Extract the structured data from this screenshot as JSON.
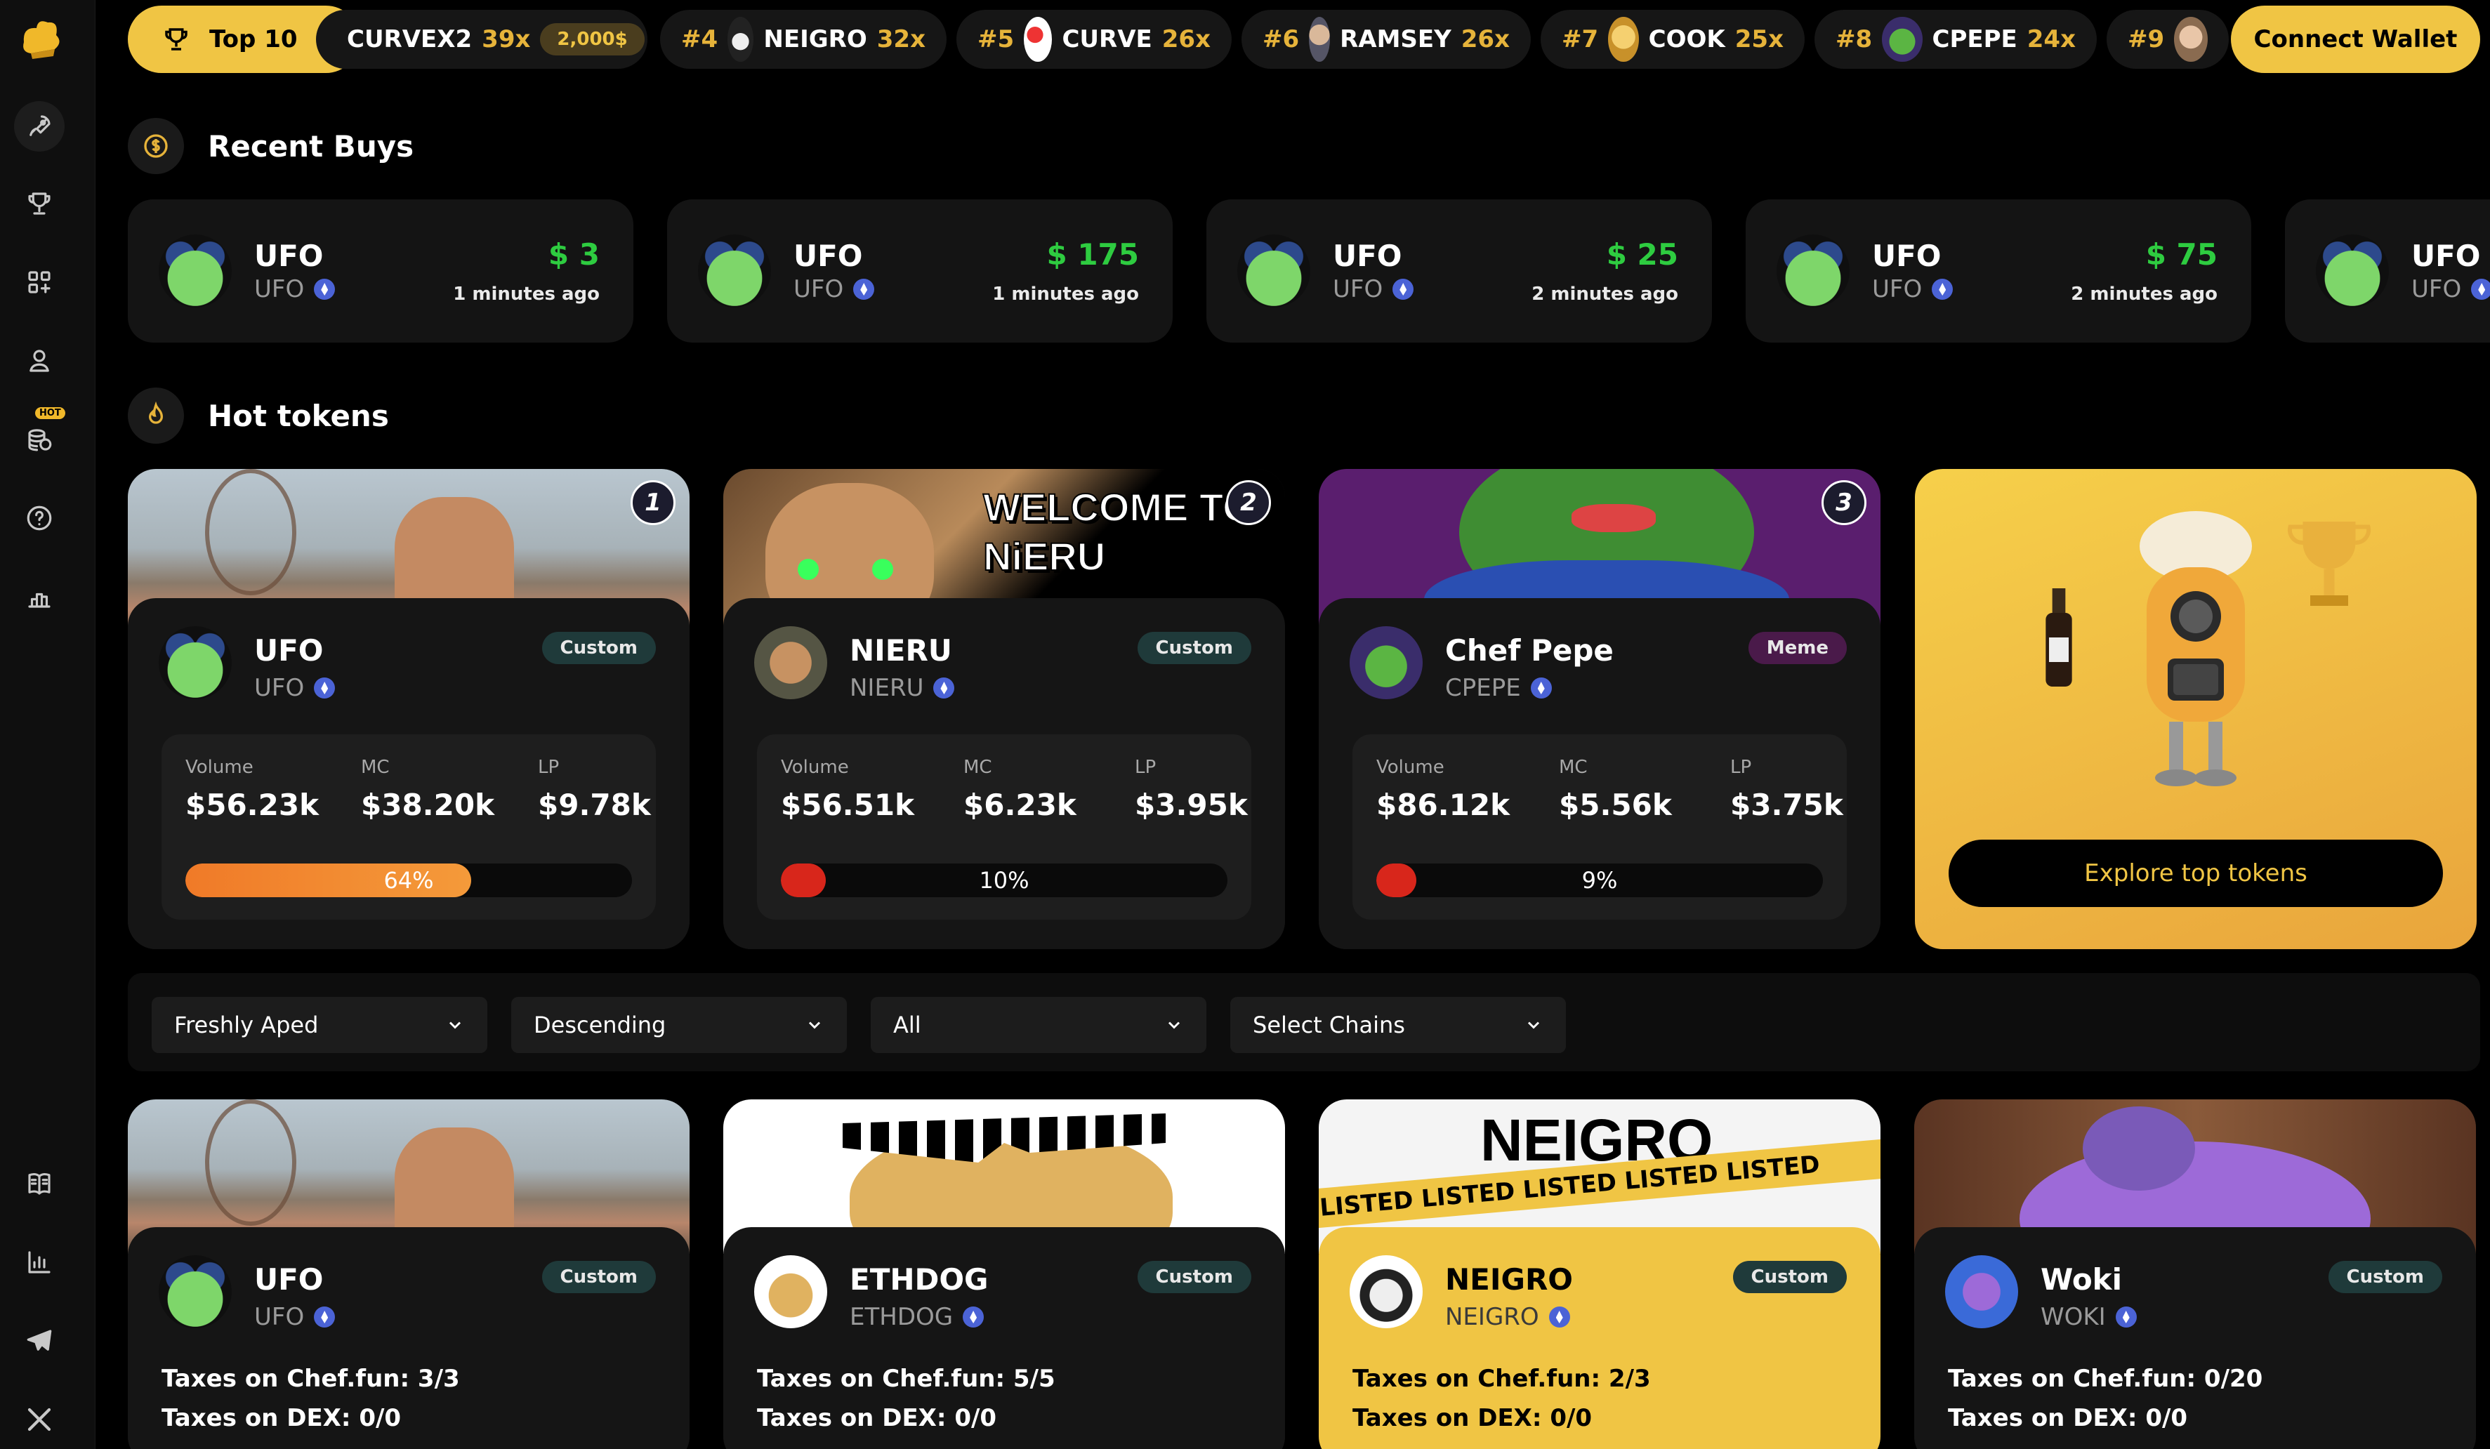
{
  "topbar": {
    "top10_label": "Top 10",
    "tickers": [
      {
        "rank": "",
        "name": "CURVEX2",
        "mult": "39x",
        "amount": "2,000$"
      },
      {
        "rank": "#4",
        "name": "NEIGRO",
        "mult": "32x"
      },
      {
        "rank": "#5",
        "name": "CURVE",
        "mult": "26x"
      },
      {
        "rank": "#6",
        "name": "RAMSEY",
        "mult": "26x"
      },
      {
        "rank": "#7",
        "name": "COOK",
        "mult": "25x"
      },
      {
        "rank": "#8",
        "name": "CPEPE",
        "mult": "24x"
      },
      {
        "rank": "#9",
        "name": "",
        "mult": ""
      }
    ],
    "connect_label": "Connect Wallet"
  },
  "recent": {
    "title": "Recent Buys",
    "items": [
      {
        "name": "UFO",
        "symbol": "UFO",
        "price": "$ 3",
        "ago": "1 minutes ago"
      },
      {
        "name": "UFO",
        "symbol": "UFO",
        "price": "$ 175",
        "ago": "1 minutes ago"
      },
      {
        "name": "UFO",
        "symbol": "UFO",
        "price": "$ 25",
        "ago": "2 minutes ago"
      },
      {
        "name": "UFO",
        "symbol": "UFO",
        "price": "$ 75",
        "ago": "2 minutes ago"
      },
      {
        "name": "UFO",
        "symbol": "UFO"
      }
    ]
  },
  "hot": {
    "title": "Hot tokens",
    "cards": [
      {
        "rank": "1",
        "name": "UFO",
        "symbol": "UFO",
        "tag": "Custom",
        "volume_label": "Volume",
        "volume": "$56.23k",
        "mc_label": "MC",
        "mc": "$38.20k",
        "lp_label": "LP",
        "lp": "$9.78k",
        "progress": 64,
        "progress_text": "64%"
      },
      {
        "rank": "2",
        "name": "NIERU",
        "symbol": "NIERU",
        "tag": "Custom",
        "volume_label": "Volume",
        "volume": "$56.51k",
        "mc_label": "MC",
        "mc": "$6.23k",
        "lp_label": "LP",
        "lp": "$3.95k",
        "progress": 10,
        "progress_text": "10%",
        "banner_text": "WELCOME TO NiERU"
      },
      {
        "rank": "3",
        "name": "Chef Pepe",
        "symbol": "CPEPE",
        "tag": "Meme",
        "volume_label": "Volume",
        "volume": "$86.12k",
        "mc_label": "MC",
        "mc": "$5.56k",
        "lp_label": "LP",
        "lp": "$3.75k",
        "progress": 9,
        "progress_text": "9%"
      }
    ],
    "explore_label": "Explore top tokens"
  },
  "filters": {
    "sort": "Freshly Aped",
    "order": "Descending",
    "type": "All",
    "chains": "Select Chains"
  },
  "tokens": [
    {
      "name": "UFO",
      "symbol": "UFO",
      "tag": "Custom",
      "tax_chef": "Taxes on Chef.fun: 3/3",
      "tax_dex": "Taxes on DEX: 0/0"
    },
    {
      "name": "ETHDOG",
      "symbol": "ETHDOG",
      "tag": "Custom",
      "tax_chef": "Taxes on Chef.fun: 5/5",
      "tax_dex": "Taxes on DEX: 0/0"
    },
    {
      "name": "NEIGRO",
      "symbol": "NEIGRO",
      "tag": "Custom",
      "tax_chef": "Taxes on Chef.fun: 2/3",
      "tax_dex": "Taxes on DEX: 0/0",
      "banner_text": "NEIGRO",
      "banner_listed": "LISTED LISTED LISTED LISTED LISTED"
    },
    {
      "name": "Woki",
      "symbol": "WOKI",
      "tag": "Custom",
      "tax_chef": "Taxes on Chef.fun: 0/20",
      "tax_dex": "Taxes on DEX: 0/0"
    }
  ],
  "sidebar": {
    "hot_badge": "HOT"
  },
  "colors": {
    "accent": "#f0c544",
    "green": "#2ecc40",
    "progress_orange": "#f07a28",
    "progress_red": "#d8261b"
  }
}
